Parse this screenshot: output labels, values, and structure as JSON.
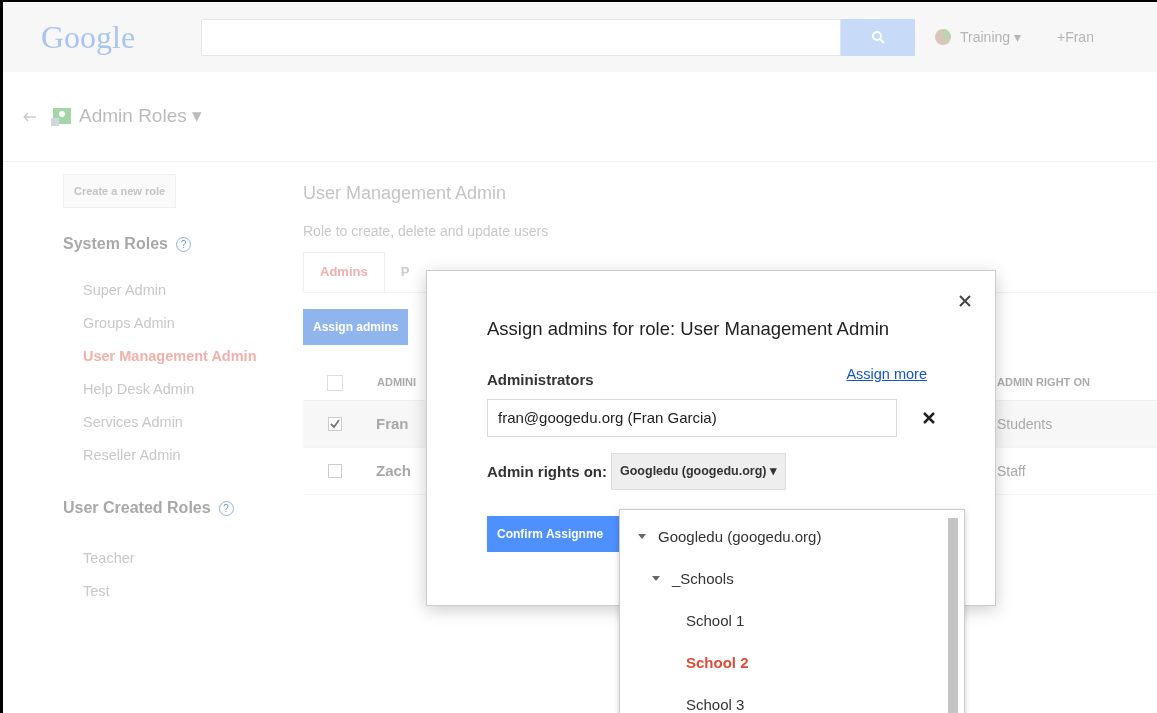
{
  "header": {
    "logo": "Google",
    "account": "Training ▾",
    "user": "+Fran"
  },
  "app_bar": {
    "title": "Admin Roles ▾"
  },
  "sidebar": {
    "create_button": "Create a new role",
    "sections": [
      {
        "title": "System Roles",
        "help": "?",
        "items": [
          {
            "label": "Super Admin",
            "selected": false
          },
          {
            "label": "Groups Admin",
            "selected": false
          },
          {
            "label": "User Management Admin",
            "selected": true
          },
          {
            "label": "Help Desk Admin",
            "selected": false
          },
          {
            "label": "Services Admin",
            "selected": false
          },
          {
            "label": "Reseller Admin",
            "selected": false
          }
        ]
      },
      {
        "title": "User Created Roles",
        "help": "?",
        "items": [
          {
            "label": "Teacher",
            "selected": false
          },
          {
            "label": "Test",
            "selected": false
          }
        ]
      }
    ]
  },
  "role": {
    "title": "User Management Admin",
    "description": "Role to create, delete and update users"
  },
  "tabs": [
    {
      "label": "Admins",
      "selected": true
    },
    {
      "label": "P",
      "selected": false
    }
  ],
  "assign_button": "Assign admins",
  "table": {
    "all_checked": false,
    "columns": [
      "ADMINI",
      "ADMIN RIGHT ON"
    ],
    "rows": [
      {
        "name": "Fran",
        "rights": "Students",
        "checked": true
      },
      {
        "name": "Zach",
        "rights": "Staff",
        "checked": false
      }
    ]
  },
  "dialog": {
    "title": "Assign admins for role: User Management Admin",
    "administrators_label": "Administrators",
    "assign_more": "Assign more",
    "admin_value": "fran@googedu.org (Fran Garcia)",
    "rights_label": "Admin rights on:",
    "rights_value": "Googledu (googedu.org) ▾",
    "confirm": "Confirm Assignme"
  },
  "org_tree": [
    {
      "label": "Googledu (googedu.org)",
      "expanded": true,
      "selected": false,
      "children": [
        {
          "label": "_Schools",
          "expanded": true,
          "selected": false,
          "children": [
            {
              "label": "School 1",
              "selected": false
            },
            {
              "label": "School 2",
              "selected": true
            },
            {
              "label": "School 3",
              "selected": false
            }
          ]
        }
      ]
    }
  ]
}
